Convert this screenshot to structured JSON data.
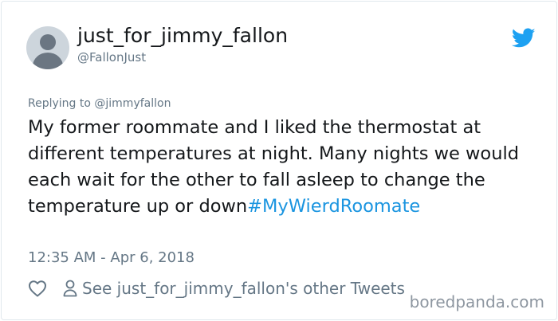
{
  "author": {
    "display_name": "just_for_jimmy_fallon",
    "handle": "@FallonJust"
  },
  "reply": {
    "prefix": "Replying to ",
    "to": "@jimmyfallon"
  },
  "tweet": {
    "text": "My former roommate and I liked the thermostat at different temperatures at night. Many nights we would each wait for the other to fall asleep to change the temperature up or down",
    "hashtag": "#MyWierdRoomate",
    "timestamp": "12:35 AM - Apr 6, 2018"
  },
  "footer": {
    "other_tweets_label": "See just_for_jimmy_fallon's other Tweets"
  },
  "watermark": "boredpanda.com",
  "colors": {
    "accent": "#1b95e0",
    "muted": "#657786",
    "text": "#14171a",
    "border": "#e1e8ed"
  },
  "icons": {
    "platform": "twitter-bird-icon",
    "like": "heart-icon",
    "profile": "person-icon"
  }
}
